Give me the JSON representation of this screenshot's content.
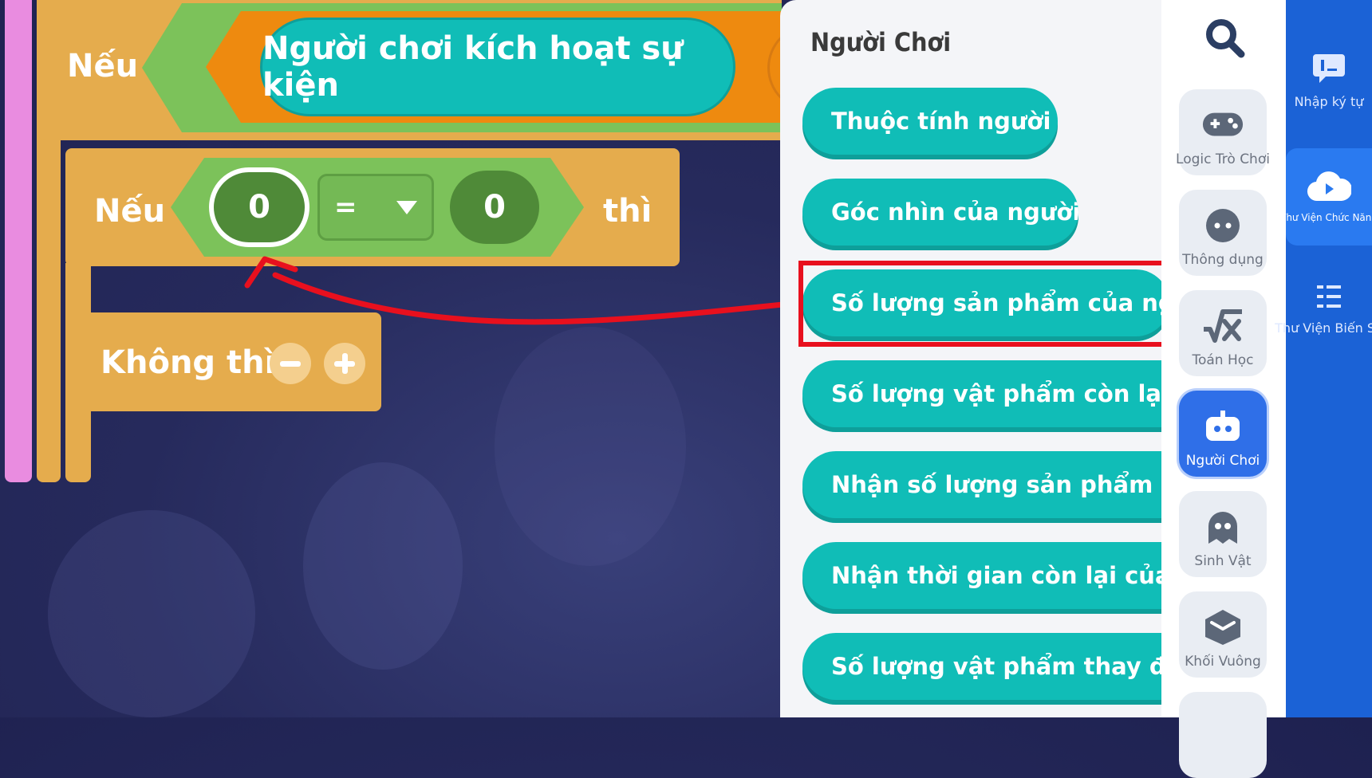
{
  "workspace": {
    "if_label_1": "Nếu",
    "event_block": "Người chơi kích hoạt sự kiện",
    "if_label_2": "Nếu",
    "compare_left": "0",
    "compare_op": "=",
    "compare_right": "0",
    "then_label": "thì",
    "else_label": "Không thì"
  },
  "panel": {
    "title": "Người Chơi",
    "blocks": [
      "Thuộc tính người chơi",
      "Góc nhìn của người chơi",
      "Số lượng sản phẩm của người chơi",
      "Số lượng vật phẩm còn lại balô người chơi",
      "Nhận số lượng sản phẩm của người chơi",
      "Nhận thời gian còn lại của trạng thái",
      "Số lượng vật phẩm thay đổi trong balô"
    ],
    "highlighted_index": 2
  },
  "categories": [
    {
      "label": "Logic Trò Chơi",
      "icon": "gamepad-icon"
    },
    {
      "label": "Thông dụng",
      "icon": "dots-icon"
    },
    {
      "label": "Toán Học",
      "icon": "math-icon"
    },
    {
      "label": "Người Chơi",
      "icon": "player-icon",
      "active": true
    },
    {
      "label": "Sinh Vật",
      "icon": "creature-icon"
    },
    {
      "label": "Khối Vuông",
      "icon": "cube-icon"
    }
  ],
  "rail": [
    {
      "label": "Nhập ký tự",
      "icon": "text-input-icon"
    },
    {
      "label": "Thư Viện Chức Năng",
      "icon": "function-library-icon",
      "active": true
    },
    {
      "label": "Thư Viện Biến Số",
      "icon": "variable-library-icon"
    }
  ],
  "colors": {
    "block_orange": "#e5ac4d",
    "logic_green": "#7cc25a",
    "event_orange": "#ee8a0f",
    "player_teal": "#10bdb7",
    "highlight_red": "#e8101e",
    "active_blue": "#2f6fe8",
    "rail_blue": "#1b62d6"
  }
}
